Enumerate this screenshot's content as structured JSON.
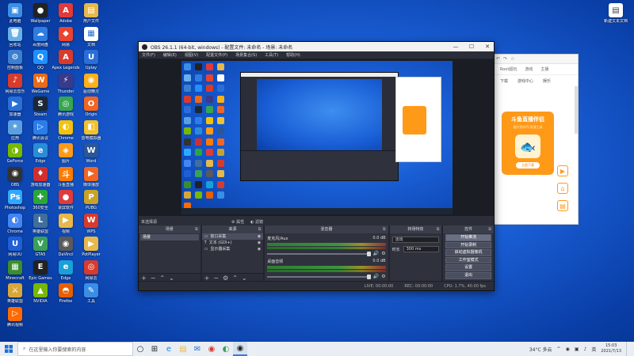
{
  "desktop": {
    "icons": [
      {
        "label": "此电脑",
        "color": "#3a8ee6",
        "glyph": "▣"
      },
      {
        "label": "Wallpaper",
        "color": "#222222",
        "glyph": "●"
      },
      {
        "label": "Adobe",
        "color": "#e03a3a",
        "glyph": "A"
      },
      {
        "label": "用户文件",
        "color": "#e8b84a",
        "glyph": "▤"
      },
      {
        "label": "回收站",
        "color": "#6ab0e8",
        "glyph": "🗑"
      },
      {
        "label": "百度网盘",
        "color": "#2f7de1",
        "glyph": "☁"
      },
      {
        "label": "网易",
        "color": "#e9442f",
        "glyph": "◆"
      },
      {
        "label": "文档",
        "color": "#ffffff",
        "glyph": "▦"
      },
      {
        "label": "控制面板",
        "color": "#3b7fd0",
        "glyph": "⚙"
      },
      {
        "label": "QQ",
        "color": "#1e90ff",
        "glyph": "Q"
      },
      {
        "label": "Apex Legends",
        "color": "#d83b2c",
        "glyph": "A"
      },
      {
        "label": "Uplay",
        "color": "#2a6fd8",
        "glyph": "U"
      },
      {
        "label": "网易云音乐",
        "color": "#d83b2c",
        "glyph": "♪"
      },
      {
        "label": "WeGame",
        "color": "#e96a1a",
        "glyph": "W"
      },
      {
        "label": "Thunder",
        "color": "#3a3a8a",
        "glyph": "⚡"
      },
      {
        "label": "驱动精灵",
        "color": "#ffb01a",
        "glyph": "◉"
      },
      {
        "label": "加速器",
        "color": "#2a6fd8",
        "glyph": "▶"
      },
      {
        "label": "Steam",
        "color": "#1b2838",
        "glyph": "S"
      },
      {
        "label": "腾讯游戏",
        "color": "#36a64f",
        "glyph": "◎"
      },
      {
        "label": "Origin",
        "color": "#f26522",
        "glyph": "O"
      },
      {
        "label": "应用",
        "color": "#5aa0e0",
        "glyph": "✶"
      },
      {
        "label": "腾讯会议",
        "color": "#2b7de9",
        "glyph": "▷"
      },
      {
        "label": "Chrome",
        "color": "#f4c20d",
        "glyph": "◐"
      },
      {
        "label": "雷电模拟器",
        "color": "#f2c12e",
        "glyph": "◧"
      },
      {
        "label": "GeForce",
        "color": "#76b900",
        "glyph": "◑"
      },
      {
        "label": "Edge",
        "color": "#2a8cd9",
        "glyph": "e"
      },
      {
        "label": "图片",
        "color": "#ff9a18",
        "glyph": "◈"
      },
      {
        "label": "Word",
        "color": "#2b5797",
        "glyph": "W"
      },
      {
        "label": "OBS",
        "color": "#333333",
        "glyph": "◉"
      },
      {
        "label": "游戏加速器",
        "color": "#d12e2e",
        "glyph": "♦"
      },
      {
        "label": "斗鱼直播",
        "color": "#ff7a00",
        "glyph": "斗"
      },
      {
        "label": "媒体播放",
        "color": "#f26522",
        "glyph": "▶"
      },
      {
        "label": "Photoshop",
        "color": "#31a8ff",
        "glyph": "Ps"
      },
      {
        "label": "360安全",
        "color": "#2aa63a",
        "glyph": "✚"
      },
      {
        "label": "录屏软件",
        "color": "#e03a3a",
        "glyph": "●"
      },
      {
        "label": "PUBG",
        "color": "#c9a227",
        "glyph": "P"
      },
      {
        "label": "Chrome",
        "color": "#4285f4",
        "glyph": "◐"
      },
      {
        "label": "英雄联盟",
        "color": "#3f6f9a",
        "glyph": "L"
      },
      {
        "label": "视频",
        "color": "#e8b84a",
        "glyph": "▶"
      },
      {
        "label": "WPS",
        "color": "#d83b2c",
        "glyph": "W"
      },
      {
        "label": "网易UU",
        "color": "#1f5fd6",
        "glyph": "U"
      },
      {
        "label": "GTA5",
        "color": "#3aa05a",
        "glyph": "V"
      },
      {
        "label": "DaVinci",
        "color": "#5a5a5a",
        "glyph": "◉"
      },
      {
        "label": "PotPlayer",
        "color": "#e8b84a",
        "glyph": "▶"
      },
      {
        "label": "Minecraft",
        "color": "#3c8d2f",
        "glyph": "▦"
      },
      {
        "label": "Epic Games",
        "color": "#222222",
        "glyph": "E"
      },
      {
        "label": "Edge",
        "color": "#1aa0d8",
        "glyph": "e"
      },
      {
        "label": "网易云",
        "color": "#d83b2c",
        "glyph": "◎"
      },
      {
        "label": "英雄联盟",
        "color": "#d8a73a",
        "glyph": "⚔"
      },
      {
        "label": "NVIDIA",
        "color": "#76b900",
        "glyph": "▲"
      },
      {
        "label": "Firefox",
        "color": "#e66000",
        "glyph": "◓"
      },
      {
        "label": "工具",
        "color": "#3a8ee6",
        "glyph": "✎"
      },
      {
        "label": "腾讯视频",
        "color": "#ff6a00",
        "glyph": "▷"
      }
    ],
    "top_right_icon": {
      "label": "新建文本文档",
      "glyph": "▤"
    }
  },
  "obs": {
    "title": "OBS 26.1.1 (64-bit, windows) - 配置文件: 未命名 - 场景: 未命名",
    "window_buttons": [
      "—",
      "☐",
      "✕"
    ],
    "menu": [
      "文件(F)",
      "编辑(E)",
      "视图(V)",
      "配置文件(P)",
      "场景集合(S)",
      "工具(T)",
      "帮助(H)"
    ],
    "source_bar": {
      "label": "未选择源",
      "props": "⚙ 属性",
      "filters": "◐ 滤镜"
    },
    "panels": {
      "scenes": {
        "title": "场景",
        "items": [
          "场景"
        ]
      },
      "sources": {
        "title": "来源",
        "items": [
          {
            "label": "窗口采集",
            "icon": "▭"
          },
          {
            "label": "文本 (GDI+)",
            "icon": "T"
          },
          {
            "label": "显示器采集",
            "icon": "▭"
          }
        ]
      },
      "mixer": {
        "title": "混音器",
        "channels": [
          {
            "name": "麦克风/Aux",
            "db": "0.0 dB"
          },
          {
            "name": "桌面音频",
            "db": "0.0 dB"
          }
        ]
      },
      "transitions": {
        "title": "转场特效",
        "selected": "淡出",
        "duration_label": "时长",
        "duration_value": "300 ms"
      },
      "controls": {
        "title": "控件",
        "buttons": [
          "开始推流",
          "开始录制",
          "启动虚拟摄像机",
          "工作室模式",
          "设置",
          "退出"
        ]
      }
    },
    "status": {
      "live": "LIVE: 00:00:00",
      "rec": "REC: 00:00:00",
      "cpu": "CPU: 1.7%, 40.00 fps"
    }
  },
  "browser": {
    "toolbar_items": [
      "✂",
      "↶",
      "↷",
      "☆"
    ],
    "address_items": [
      "Root超玩",
      "游戏",
      "主播"
    ],
    "tabs": [
      "下载",
      "游戏中心",
      "娱乐"
    ],
    "promo_title": "斗鱼直播伴侣",
    "promo_sub": "最好用的PC直播工具",
    "promo_button": "立即下载",
    "side_buttons": [
      "▶",
      "⌂",
      "▤"
    ]
  },
  "taskbar": {
    "search_placeholder": "在这里输入你要搜索的内容",
    "apps": [
      "○",
      "⊞",
      "e",
      "▤",
      "✉",
      "◉",
      "◐",
      "◉"
    ],
    "weather": "34°C 多云",
    "tray_icons": [
      "^",
      "◉",
      "▣",
      "♪",
      "英"
    ],
    "time": "15:03",
    "date": "2021/7/13"
  }
}
